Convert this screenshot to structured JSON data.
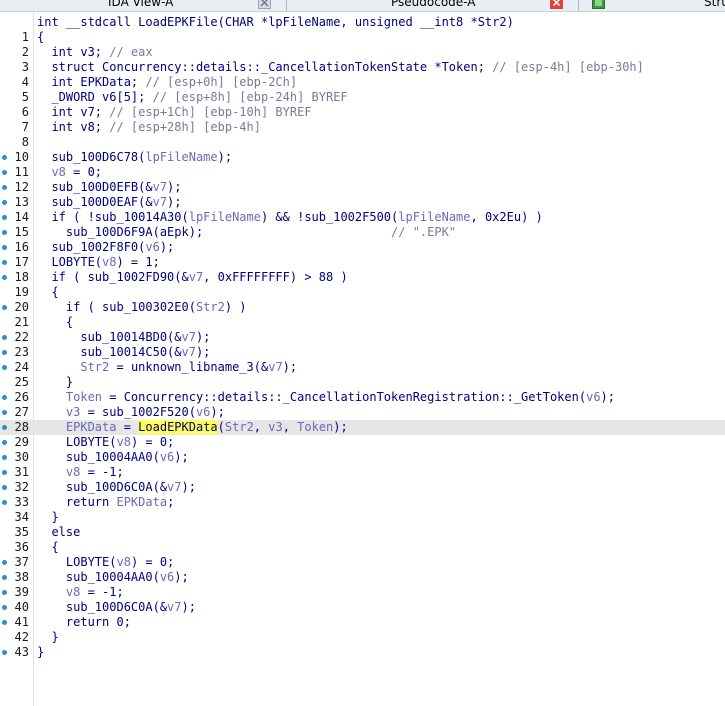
{
  "tabs": [
    {
      "label": "IDA View-A"
    },
    {
      "label": "Pseudocode-A"
    },
    {
      "label": "Stru"
    }
  ],
  "code_lines": [
    {
      "n": "",
      "bp": false,
      "parts": [
        [
          "t",
          "int __stdcall LoadEPKFile(CHAR *lpFileName, unsigned __int8 *Str2)"
        ]
      ]
    },
    {
      "n": "1",
      "bp": false,
      "parts": [
        [
          "t",
          "{"
        ]
      ]
    },
    {
      "n": "2",
      "bp": false,
      "parts": [
        [
          "t",
          "  int v3; "
        ],
        [
          "c",
          "// eax"
        ]
      ]
    },
    {
      "n": "3",
      "bp": false,
      "parts": [
        [
          "t",
          "  struct Concurrency::details::_CancellationTokenState *Token; "
        ],
        [
          "c",
          "// [esp-4h] [ebp-30h]"
        ]
      ]
    },
    {
      "n": "4",
      "bp": false,
      "parts": [
        [
          "t",
          "  int EPKData; "
        ],
        [
          "c",
          "// [esp+0h] [ebp-2Ch]"
        ]
      ]
    },
    {
      "n": "5",
      "bp": false,
      "parts": [
        [
          "t",
          "  _DWORD v6[5]; "
        ],
        [
          "c",
          "// [esp+8h] [ebp-24h] BYREF"
        ]
      ]
    },
    {
      "n": "6",
      "bp": false,
      "parts": [
        [
          "t",
          "  int v7; "
        ],
        [
          "c",
          "// [esp+1Ch] [ebp-10h] BYREF"
        ]
      ]
    },
    {
      "n": "7",
      "bp": false,
      "parts": [
        [
          "t",
          "  int v8; "
        ],
        [
          "c",
          "// [esp+28h] [ebp-4h]"
        ]
      ]
    },
    {
      "n": "8",
      "bp": false,
      "parts": [
        [
          "t",
          ""
        ]
      ]
    },
    {
      "n": "10",
      "bp": true,
      "parts": [
        [
          "t",
          "  sub_100D6C78("
        ],
        [
          "v",
          "lpFileName"
        ],
        [
          "t",
          ");"
        ]
      ]
    },
    {
      "n": "11",
      "bp": true,
      "parts": [
        [
          "t",
          "  "
        ],
        [
          "v",
          "v8"
        ],
        [
          "t",
          " = 0;"
        ]
      ]
    },
    {
      "n": "12",
      "bp": true,
      "parts": [
        [
          "t",
          "  sub_100D0EFB(&"
        ],
        [
          "v",
          "v7"
        ],
        [
          "t",
          ");"
        ]
      ]
    },
    {
      "n": "13",
      "bp": true,
      "parts": [
        [
          "t",
          "  sub_100D0EAF(&"
        ],
        [
          "v",
          "v7"
        ],
        [
          "t",
          ");"
        ]
      ]
    },
    {
      "n": "14",
      "bp": true,
      "parts": [
        [
          "t",
          "  if ( !sub_10014A30("
        ],
        [
          "v",
          "lpFileName"
        ],
        [
          "t",
          ") && !sub_1002F500("
        ],
        [
          "v",
          "lpFileName"
        ],
        [
          "t",
          ", 0x2Eu) )"
        ]
      ]
    },
    {
      "n": "15",
      "bp": true,
      "parts": [
        [
          "t",
          "    sub_100D6F9A(aEpk);                          "
        ],
        [
          "c",
          "// \".EPK\""
        ]
      ]
    },
    {
      "n": "16",
      "bp": true,
      "parts": [
        [
          "t",
          "  sub_1002F8F0("
        ],
        [
          "v",
          "v6"
        ],
        [
          "t",
          ");"
        ]
      ]
    },
    {
      "n": "17",
      "bp": true,
      "parts": [
        [
          "t",
          "  LOBYTE("
        ],
        [
          "v",
          "v8"
        ],
        [
          "t",
          ") = 1;"
        ]
      ]
    },
    {
      "n": "18",
      "bp": true,
      "parts": [
        [
          "t",
          "  if ( sub_1002FD90(&"
        ],
        [
          "v",
          "v7"
        ],
        [
          "t",
          ", 0xFFFFFFFF) > 88 )"
        ]
      ]
    },
    {
      "n": "19",
      "bp": false,
      "parts": [
        [
          "t",
          "  {"
        ]
      ]
    },
    {
      "n": "20",
      "bp": true,
      "parts": [
        [
          "t",
          "    if ( sub_100302E0("
        ],
        [
          "v",
          "Str2"
        ],
        [
          "t",
          ") )"
        ]
      ]
    },
    {
      "n": "21",
      "bp": false,
      "parts": [
        [
          "t",
          "    {"
        ]
      ]
    },
    {
      "n": "22",
      "bp": true,
      "parts": [
        [
          "t",
          "      sub_10014BD0(&"
        ],
        [
          "v",
          "v7"
        ],
        [
          "t",
          ");"
        ]
      ]
    },
    {
      "n": "23",
      "bp": true,
      "parts": [
        [
          "t",
          "      sub_10014C50(&"
        ],
        [
          "v",
          "v7"
        ],
        [
          "t",
          ");"
        ]
      ]
    },
    {
      "n": "24",
      "bp": true,
      "parts": [
        [
          "t",
          "      "
        ],
        [
          "v",
          "Str2"
        ],
        [
          "t",
          " = unknown_libname_3(&"
        ],
        [
          "v",
          "v7"
        ],
        [
          "t",
          ");"
        ]
      ]
    },
    {
      "n": "25",
      "bp": false,
      "parts": [
        [
          "t",
          "    }"
        ]
      ]
    },
    {
      "n": "26",
      "bp": true,
      "parts": [
        [
          "t",
          "    "
        ],
        [
          "v",
          "Token"
        ],
        [
          "t",
          " = Concurrency::details::_CancellationTokenRegistration::_GetToken("
        ],
        [
          "v",
          "v6"
        ],
        [
          "t",
          ");"
        ]
      ]
    },
    {
      "n": "27",
      "bp": true,
      "parts": [
        [
          "t",
          "    "
        ],
        [
          "v",
          "v3"
        ],
        [
          "t",
          " = sub_1002F520("
        ],
        [
          "v",
          "v6"
        ],
        [
          "t",
          ");"
        ]
      ]
    },
    {
      "n": "28",
      "bp": true,
      "current": true,
      "parts": [
        [
          "t",
          "    "
        ],
        [
          "v",
          "EPKData"
        ],
        [
          "t",
          " = "
        ],
        [
          "h",
          "LoadEPKData"
        ],
        [
          "t",
          "("
        ],
        [
          "v",
          "Str2"
        ],
        [
          "t",
          ", "
        ],
        [
          "v",
          "v3"
        ],
        [
          "t",
          ", "
        ],
        [
          "v",
          "Token"
        ],
        [
          "t",
          ");"
        ]
      ]
    },
    {
      "n": "29",
      "bp": true,
      "parts": [
        [
          "t",
          "    LOBYTE("
        ],
        [
          "v",
          "v8"
        ],
        [
          "t",
          ") = 0;"
        ]
      ]
    },
    {
      "n": "30",
      "bp": true,
      "parts": [
        [
          "t",
          "    sub_10004AA0("
        ],
        [
          "v",
          "v6"
        ],
        [
          "t",
          ");"
        ]
      ]
    },
    {
      "n": "31",
      "bp": true,
      "parts": [
        [
          "t",
          "    "
        ],
        [
          "v",
          "v8"
        ],
        [
          "t",
          " = -1;"
        ]
      ]
    },
    {
      "n": "32",
      "bp": true,
      "parts": [
        [
          "t",
          "    sub_100D6C0A(&"
        ],
        [
          "v",
          "v7"
        ],
        [
          "t",
          ");"
        ]
      ]
    },
    {
      "n": "33",
      "bp": true,
      "parts": [
        [
          "t",
          "    return "
        ],
        [
          "v",
          "EPKData"
        ],
        [
          "t",
          ";"
        ]
      ]
    },
    {
      "n": "34",
      "bp": false,
      "parts": [
        [
          "t",
          "  }"
        ]
      ]
    },
    {
      "n": "35",
      "bp": false,
      "parts": [
        [
          "t",
          "  else"
        ]
      ]
    },
    {
      "n": "36",
      "bp": false,
      "parts": [
        [
          "t",
          "  {"
        ]
      ]
    },
    {
      "n": "37",
      "bp": true,
      "parts": [
        [
          "t",
          "    LOBYTE("
        ],
        [
          "v",
          "v8"
        ],
        [
          "t",
          ") = 0;"
        ]
      ]
    },
    {
      "n": "38",
      "bp": true,
      "parts": [
        [
          "t",
          "    sub_10004AA0("
        ],
        [
          "v",
          "v6"
        ],
        [
          "t",
          ");"
        ]
      ]
    },
    {
      "n": "39",
      "bp": true,
      "parts": [
        [
          "t",
          "    "
        ],
        [
          "v",
          "v8"
        ],
        [
          "t",
          " = -1;"
        ]
      ]
    },
    {
      "n": "40",
      "bp": true,
      "parts": [
        [
          "t",
          "    sub_100D6C0A(&"
        ],
        [
          "v",
          "v7"
        ],
        [
          "t",
          ");"
        ]
      ]
    },
    {
      "n": "41",
      "bp": true,
      "parts": [
        [
          "t",
          "    return 0;"
        ]
      ]
    },
    {
      "n": "42",
      "bp": false,
      "parts": [
        [
          "t",
          "  }"
        ]
      ]
    },
    {
      "n": "43",
      "bp": true,
      "parts": [
        [
          "t",
          "}"
        ]
      ]
    }
  ]
}
